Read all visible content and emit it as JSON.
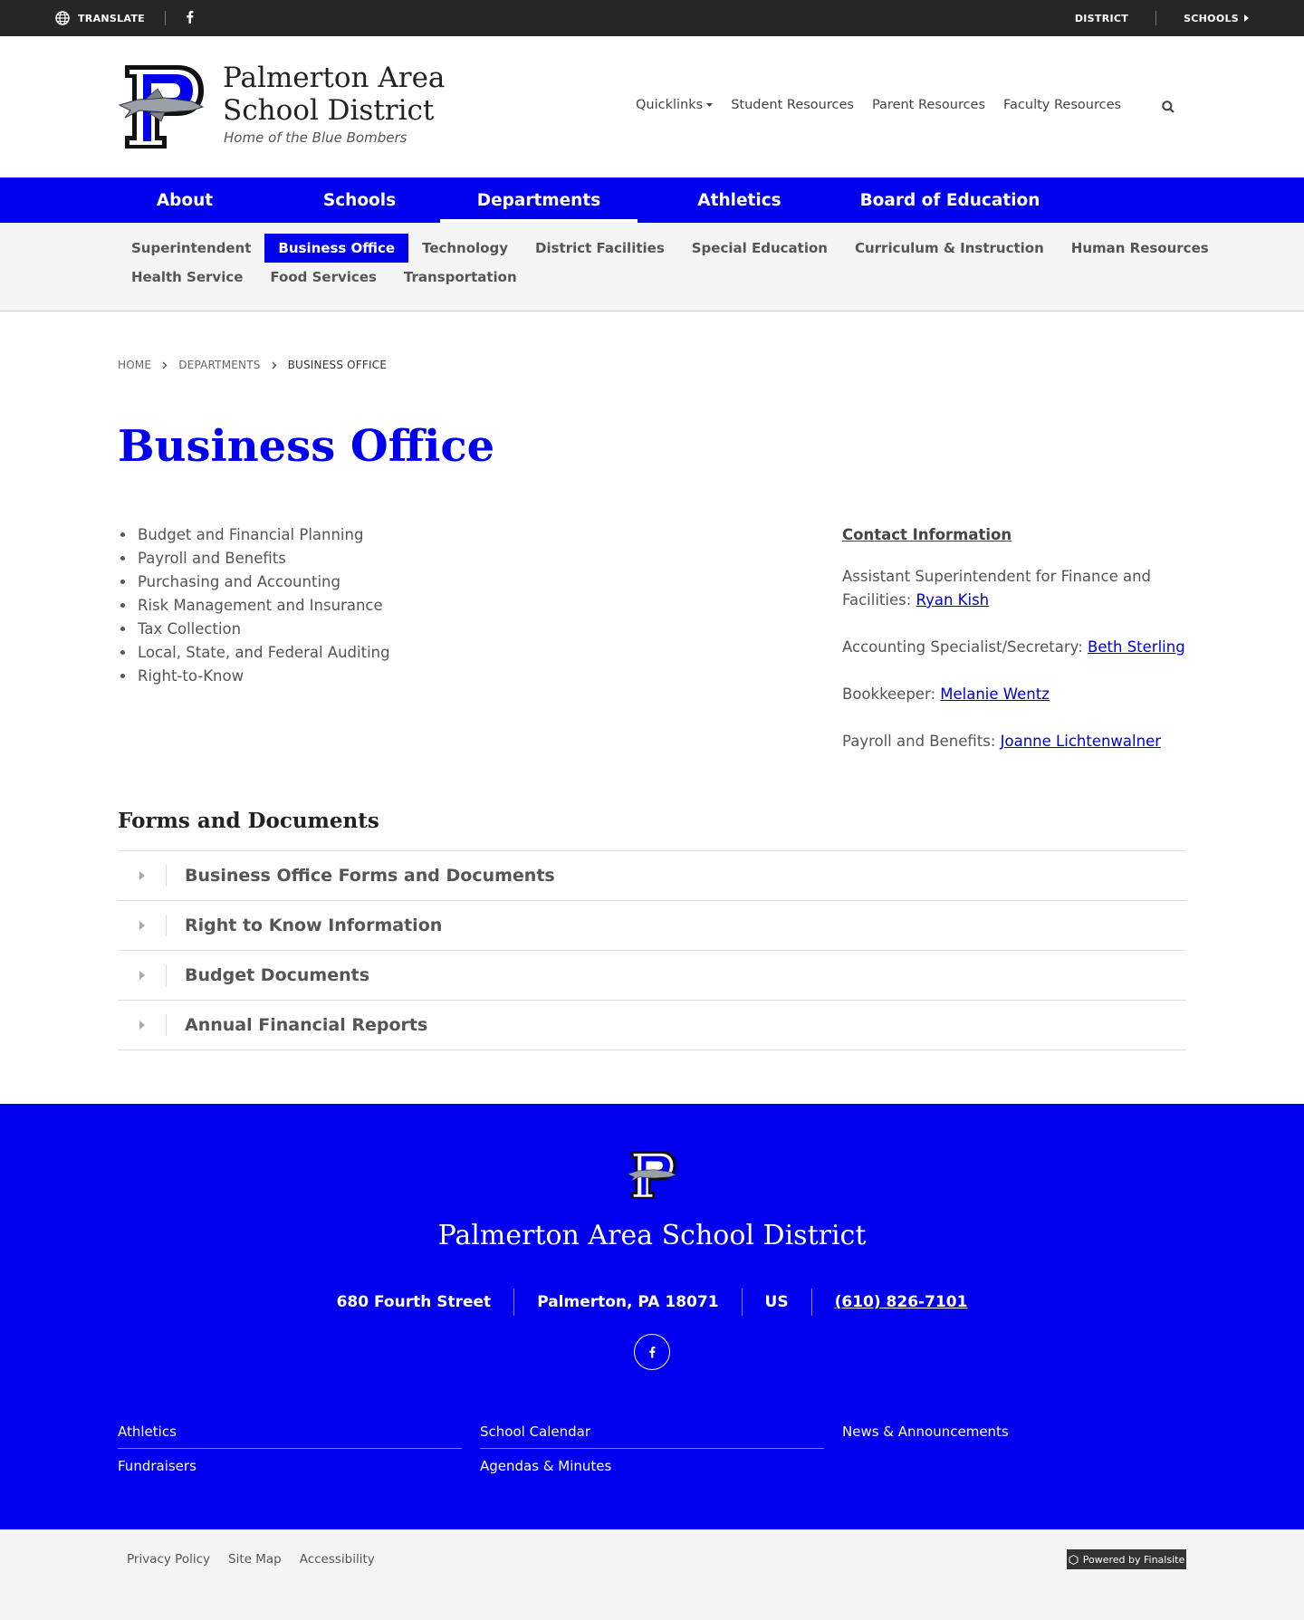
{
  "topbar": {
    "translate": "TRANSLATE",
    "district": "DISTRICT",
    "schools": "SCHOOLS"
  },
  "header": {
    "site_name": "Palmerton Area School District",
    "tagline": "Home of the Blue Bombers",
    "quicklinks": [
      "Quicklinks",
      "Student Resources",
      "Parent Resources",
      "Faculty Resources"
    ]
  },
  "mainnav": [
    "About",
    "Schools",
    "Departments",
    "Athletics",
    "Board of Education"
  ],
  "subnav": {
    "row1": [
      "Superintendent",
      "Business Office",
      "Technology",
      "District Facilities",
      "Special Education",
      "Curriculum & Instruction",
      "Human Resources"
    ],
    "row2": [
      "Health Service",
      "Food Services",
      "Transportation"
    ],
    "active": "Business Office"
  },
  "breadcrumb": [
    "HOME",
    "DEPARTMENTS",
    "BUSINESS OFFICE"
  ],
  "page_title": "Business Office",
  "services": [
    "Budget and Financial Planning",
    "Payroll and Benefits",
    "Purchasing and Accounting",
    "Risk Management and Insurance",
    "Tax Collection",
    "Local, State, and Federal Auditing",
    "Right-to-Know"
  ],
  "contact": {
    "heading": "Contact Information",
    "items": [
      {
        "role": "Assistant Superintendent for Finance and Facilities: ",
        "name": "Ryan Kish"
      },
      {
        "role": "Accounting Specialist/Secretary: ",
        "name": "Beth Sterling"
      },
      {
        "role": "Bookkeeper: ",
        "name": "Melanie Wentz"
      },
      {
        "role": "Payroll and Benefits: ",
        "name": "Joanne Lichtenwalner"
      }
    ]
  },
  "forms": {
    "heading": "Forms and Documents",
    "items": [
      "Business Office Forms and Documents",
      "Right to Know Information",
      "Budget Documents",
      "Annual Financial Reports"
    ]
  },
  "footer": {
    "name": "Palmerton Area School District",
    "street": "680 Fourth Street",
    "city": "Palmerton, PA  18071",
    "country": "US",
    "phone": "(610) 826-7101",
    "links": [
      "Athletics",
      "School Calendar",
      "News & Announcements",
      "Fundraisers",
      "Agendas & Minutes"
    ]
  },
  "bottom": {
    "links": [
      "Privacy Policy",
      "Site Map",
      "Accessibility"
    ],
    "powered": "Powered by Finalsite"
  },
  "colors": {
    "brand_blue": "#0000ee",
    "topbar": "#262626"
  }
}
